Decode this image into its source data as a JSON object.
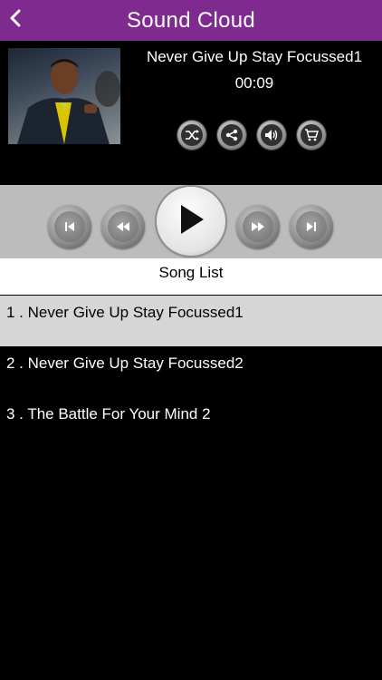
{
  "header": {
    "title": "Sound Cloud",
    "back_icon": "chevron-left-icon"
  },
  "now_playing": {
    "track_title": "Never Give Up Stay Focussed1",
    "time": "00:09",
    "actions": [
      "shuffle-icon",
      "share-icon",
      "volume-icon",
      "cart-icon"
    ]
  },
  "controls": [
    "skip-previous-icon",
    "rewind-icon",
    "play-icon",
    "fast-forward-icon",
    "skip-next-icon"
  ],
  "song_list": {
    "title": "Song List",
    "items": [
      {
        "label": "1 . Never Give Up Stay Focussed1",
        "active": true
      },
      {
        "label": "2 . Never Give Up Stay Focussed2",
        "active": false
      },
      {
        "label": "3 . The Battle For Your Mind 2",
        "active": false
      }
    ]
  },
  "colors": {
    "header": "#7e2a8f",
    "controls_bar": "#bcbcbc",
    "active_row": "#d6d6d6",
    "background": "#000000"
  }
}
